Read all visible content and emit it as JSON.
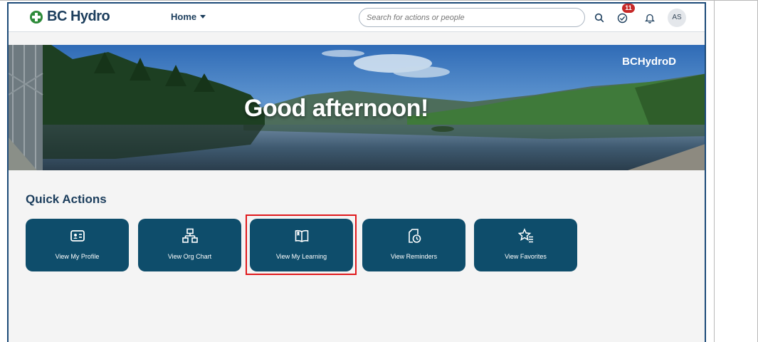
{
  "header": {
    "logo_text": "BC Hydro",
    "home_label": "Home",
    "search_placeholder": "Search for actions or people",
    "notification_count": "11",
    "avatar_initials": "AS"
  },
  "banner": {
    "greeting": "Good afternoon!",
    "environment": "BCHydroD"
  },
  "quick_actions": {
    "title": "Quick Actions",
    "tiles": [
      {
        "label": "View My Profile",
        "icon": "profile-card-icon"
      },
      {
        "label": "View Org Chart",
        "icon": "org-chart-icon"
      },
      {
        "label": "View My Learning",
        "icon": "book-icon"
      },
      {
        "label": "View Reminders",
        "icon": "reminder-clock-icon"
      },
      {
        "label": "View Favorites",
        "icon": "favorites-star-icon"
      }
    ]
  },
  "colors": {
    "brand_navy": "#1b3d5c",
    "tile_bg": "#0e4d6b",
    "logo_green": "#2e8b3a",
    "badge_red": "#c62828",
    "highlight_red": "#e0191c"
  }
}
